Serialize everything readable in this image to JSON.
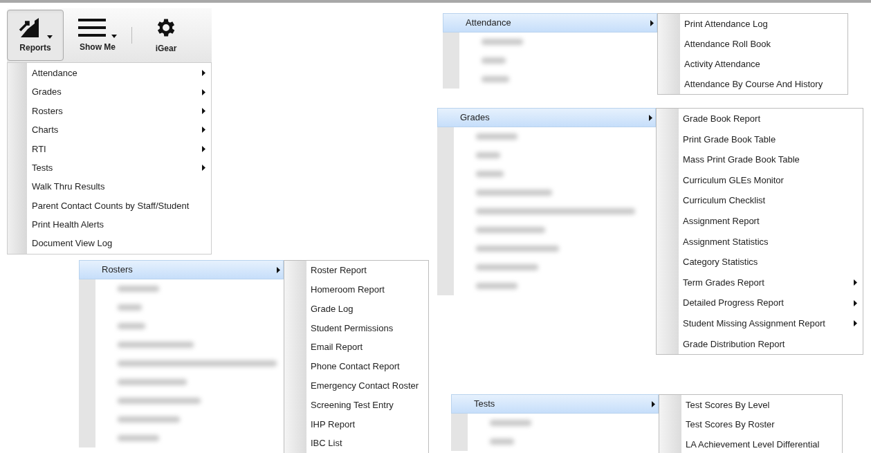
{
  "main_menu": {
    "toolbar": [
      {
        "kind": "chart",
        "label": "Reports",
        "pressed": true,
        "dropdown": true
      },
      {
        "kind": "menu",
        "label": "Show Me",
        "pressed": false,
        "dropdown": true
      },
      {
        "kind": "gear",
        "label": "iGear",
        "pressed": false,
        "dropdown": false
      }
    ],
    "items": [
      {
        "label": "Attendance",
        "submenu": true
      },
      {
        "label": "Grades",
        "submenu": true
      },
      {
        "label": "Rosters",
        "submenu": true
      },
      {
        "label": "Charts",
        "submenu": true
      },
      {
        "label": "RTI",
        "submenu": true
      },
      {
        "label": "Tests",
        "submenu": true
      },
      {
        "label": "Walk Thru Results",
        "submenu": false
      },
      {
        "label": "Parent Contact Counts by Staff/Student",
        "submenu": false
      },
      {
        "label": "Print Health Alerts",
        "submenu": false
      },
      {
        "label": "Document View Log",
        "submenu": false
      }
    ]
  },
  "submenus": [
    {
      "parent": "Rosters",
      "items": [
        {
          "label": "Roster Report",
          "submenu": false
        },
        {
          "label": "Homeroom Report",
          "submenu": false
        },
        {
          "label": "Grade Log",
          "submenu": false
        },
        {
          "label": "Student Permissions",
          "submenu": false
        },
        {
          "label": "Email Report",
          "submenu": false
        },
        {
          "label": "Phone Contact Report",
          "submenu": false
        },
        {
          "label": "Emergency Contact Roster",
          "submenu": false
        },
        {
          "label": "Screening Test Entry",
          "submenu": false
        },
        {
          "label": "IHP Report",
          "submenu": false
        },
        {
          "label": "IBC List",
          "submenu": false
        }
      ]
    },
    {
      "parent": "Attendance",
      "items": [
        {
          "label": "Print Attendance Log",
          "submenu": false
        },
        {
          "label": "Attendance Roll Book",
          "submenu": false
        },
        {
          "label": "Activity Attendance",
          "submenu": false
        },
        {
          "label": "Attendance By Course And History",
          "submenu": false
        }
      ]
    },
    {
      "parent": "Grades",
      "items": [
        {
          "label": "Grade Book Report",
          "submenu": false
        },
        {
          "label": "Print Grade Book Table",
          "submenu": false
        },
        {
          "label": "Mass Print Grade Book Table",
          "submenu": false
        },
        {
          "label": "Curriculum GLEs Monitor",
          "submenu": false
        },
        {
          "label": "Curriculum Checklist",
          "submenu": false
        },
        {
          "label": "Assignment Report",
          "submenu": false
        },
        {
          "label": "Assignment Statistics",
          "submenu": false
        },
        {
          "label": "Category Statistics",
          "submenu": false
        },
        {
          "label": "Term Grades Report",
          "submenu": true
        },
        {
          "label": "Detailed Progress Report",
          "submenu": true
        },
        {
          "label": "Student Missing Assignment Report",
          "submenu": true
        },
        {
          "label": "Grade Distribution Report",
          "submenu": false
        }
      ]
    },
    {
      "parent": "Tests",
      "items": [
        {
          "label": "Test Scores By Level",
          "submenu": false
        },
        {
          "label": "Test Scores By Roster",
          "submenu": false
        },
        {
          "label": "LA Achievement Level Differential",
          "submenu": false
        }
      ]
    }
  ]
}
